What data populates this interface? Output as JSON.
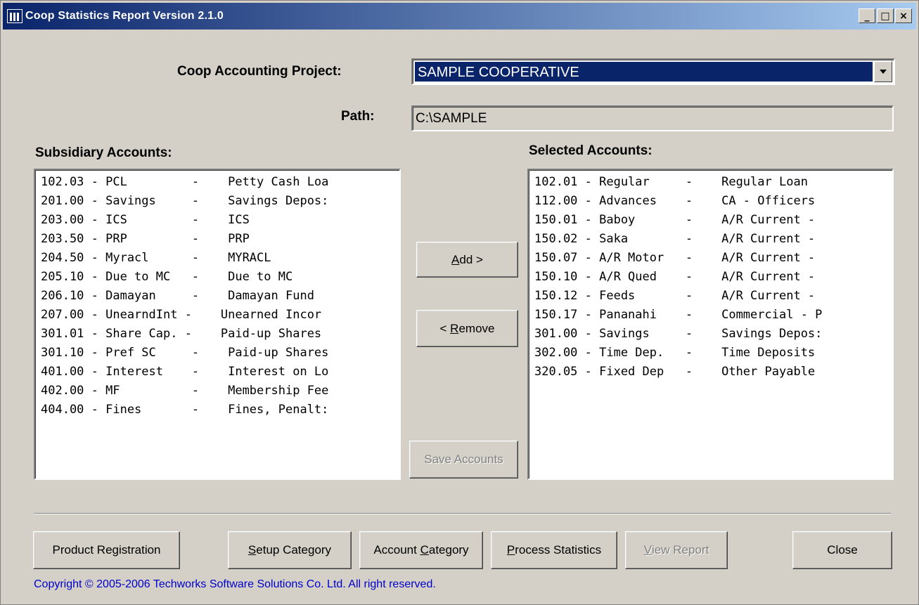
{
  "window": {
    "title": "Coop Statistics Report Version 2.1.0",
    "controls": [
      "_",
      "□",
      "×"
    ]
  },
  "project": {
    "label": "Coop Accounting Project:",
    "selected": "SAMPLE COOPERATIVE"
  },
  "path": {
    "label": "Path:",
    "value": "C:\\SAMPLE"
  },
  "subsidiary": {
    "label": "Subsidiary Accounts:",
    "items": [
      "102.03 - PCL         -    Petty Cash Loa",
      "201.00 - Savings     -    Savings Depos:",
      "203.00 - ICS         -    ICS",
      "203.50 - PRP         -    PRP",
      "204.50 - Myracl      -    MYRACL",
      "205.10 - Due to MC   -    Due to MC",
      "206.10 - Damayan     -    Damayan Fund",
      "207.00 - UnearndInt -    Unearned Incor",
      "301.01 - Share Cap. -    Paid-up Shares",
      "301.10 - Pref SC     -    Paid-up Shares",
      "401.00 - Interest    -    Interest on Lo",
      "402.00 - MF          -    Membership Fee",
      "404.00 - Fines       -    Fines, Penalt:"
    ]
  },
  "selected": {
    "label": "Selected Accounts:",
    "items": [
      "102.01 - Regular     -    Regular Loan",
      "112.00 - Advances    -    CA - Officers",
      "150.01 - Baboy       -    A/R Current -",
      "150.02 - Saka        -    A/R Current -",
      "150.07 - A/R Motor   -    A/R Current -",
      "150.10 - A/R Qued    -    A/R Current -",
      "150.12 - Feeds       -    A/R Current -",
      "150.17 - Pananahi    -    Commercial - P",
      "301.00 - Savings     -    Savings Depos:",
      "302.00 - Time Dep.   -    Time Deposits",
      "320.05 - Fixed Dep   -    Other Payable"
    ]
  },
  "buttons": {
    "add": {
      "mn": "A",
      "rest": "dd >"
    },
    "remove": {
      "pre": "< ",
      "mn": "R",
      "rest": "emove"
    },
    "save_accounts": "Save Accounts",
    "product_registration": "Product Registration",
    "setup_category": {
      "mn": "S",
      "rest": "etup Category"
    },
    "account_category": {
      "pre": "Account ",
      "mn": "C",
      "rest": "ategory"
    },
    "process_statistics": {
      "mn": "P",
      "rest": "rocess Statistics"
    },
    "view_report": {
      "mn": "V",
      "rest": "iew Report"
    },
    "close": "Close"
  },
  "footer": {
    "copyright": "Copyright © 2005-2006  Techworks Software Solutions Co. Ltd.  All right reserved."
  },
  "colors": {
    "title_start": "#0a246a",
    "title_end": "#a6caf0",
    "face": "#d4d0c8",
    "selection": "#0a246a",
    "copyright": "#0000cc"
  }
}
